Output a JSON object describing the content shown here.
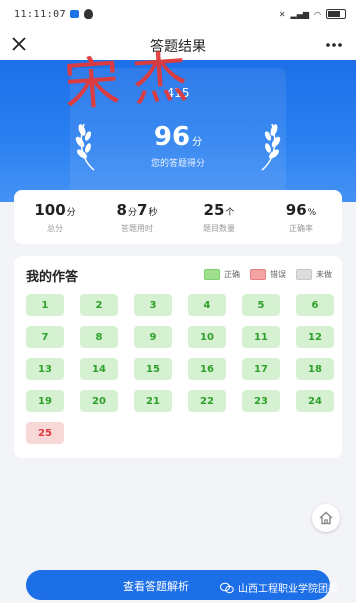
{
  "status": {
    "time": "11:11:07"
  },
  "navbar": {
    "title": "答题结果"
  },
  "banner": {
    "overlay_text": "宋杰",
    "top_number": "415",
    "score": "96",
    "score_unit": "分",
    "score_label": "您的答题得分"
  },
  "stats": [
    {
      "value": "100",
      "unit": "分",
      "label": "总分"
    },
    {
      "value": "8",
      "unit": "分",
      "value2": "7",
      "unit2": "秒",
      "label": "答题用时"
    },
    {
      "value": "25",
      "unit": "个",
      "label": "题目数量"
    },
    {
      "value": "96",
      "unit": "%",
      "label": "正确率"
    }
  ],
  "answers": {
    "title": "我的作答",
    "legend": [
      {
        "label": "正确",
        "color": "#9fe08f"
      },
      {
        "label": "错误",
        "color": "#f4a3a3"
      },
      {
        "label": "未做",
        "color": "#dcdcdc"
      }
    ],
    "items": [
      {
        "n": "1",
        "s": "correct"
      },
      {
        "n": "2",
        "s": "correct"
      },
      {
        "n": "3",
        "s": "correct"
      },
      {
        "n": "4",
        "s": "correct"
      },
      {
        "n": "5",
        "s": "correct"
      },
      {
        "n": "6",
        "s": "correct"
      },
      {
        "n": "7",
        "s": "correct"
      },
      {
        "n": "8",
        "s": "correct"
      },
      {
        "n": "9",
        "s": "correct"
      },
      {
        "n": "10",
        "s": "correct"
      },
      {
        "n": "11",
        "s": "correct"
      },
      {
        "n": "12",
        "s": "correct"
      },
      {
        "n": "13",
        "s": "correct"
      },
      {
        "n": "14",
        "s": "correct"
      },
      {
        "n": "15",
        "s": "correct"
      },
      {
        "n": "16",
        "s": "correct"
      },
      {
        "n": "17",
        "s": "correct"
      },
      {
        "n": "18",
        "s": "correct"
      },
      {
        "n": "19",
        "s": "correct"
      },
      {
        "n": "20",
        "s": "correct"
      },
      {
        "n": "21",
        "s": "correct"
      },
      {
        "n": "22",
        "s": "correct"
      },
      {
        "n": "23",
        "s": "correct"
      },
      {
        "n": "24",
        "s": "correct"
      },
      {
        "n": "25",
        "s": "wrong"
      }
    ]
  },
  "bottom": {
    "button_label": "查看答题解析",
    "watermark": "山西工程职业学院团委"
  }
}
